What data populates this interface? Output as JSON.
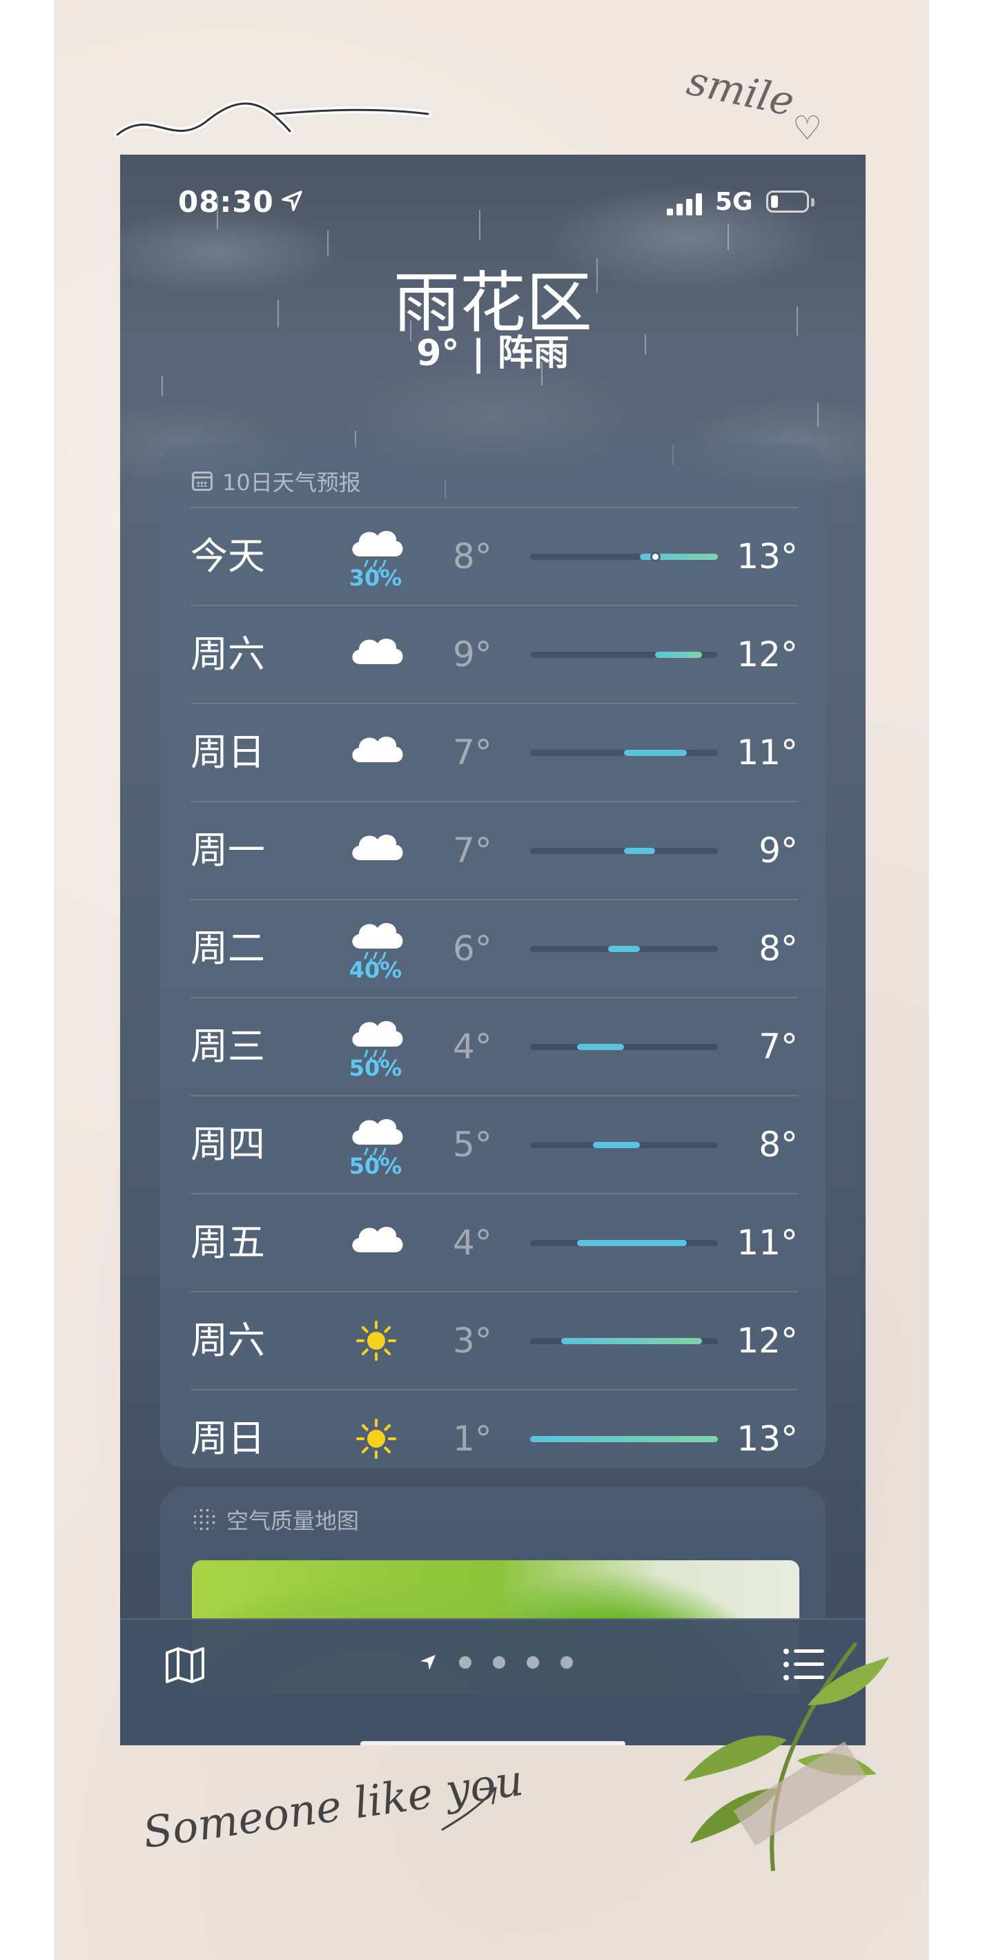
{
  "status_bar": {
    "time": "08:30",
    "network": "5G"
  },
  "location": {
    "city": "雨花区",
    "summary": "9° | 阵雨"
  },
  "forecast_card": {
    "title": "10日天气预报",
    "days": [
      {
        "day": "今天",
        "icon": "cloud-rain-icon",
        "precip": "30%",
        "low": "8°",
        "high": "13°",
        "low_value": 8,
        "high_value": 13,
        "current": 9
      },
      {
        "day": "周六",
        "icon": "cloud-icon",
        "precip": "",
        "low": "9°",
        "high": "12°",
        "low_value": 9,
        "high_value": 12
      },
      {
        "day": "周日",
        "icon": "cloud-icon",
        "precip": "",
        "low": "7°",
        "high": "11°",
        "low_value": 7,
        "high_value": 11
      },
      {
        "day": "周一",
        "icon": "cloud-icon",
        "precip": "",
        "low": "7°",
        "high": "9°",
        "low_value": 7,
        "high_value": 9
      },
      {
        "day": "周二",
        "icon": "cloud-rain-icon",
        "precip": "40%",
        "low": "6°",
        "high": "8°",
        "low_value": 6,
        "high_value": 8
      },
      {
        "day": "周三",
        "icon": "cloud-rain-icon",
        "precip": "50%",
        "low": "4°",
        "high": "7°",
        "low_value": 4,
        "high_value": 7
      },
      {
        "day": "周四",
        "icon": "cloud-rain-icon",
        "precip": "50%",
        "low": "5°",
        "high": "8°",
        "low_value": 5,
        "high_value": 8
      },
      {
        "day": "周五",
        "icon": "cloud-icon",
        "precip": "",
        "low": "4°",
        "high": "11°",
        "low_value": 4,
        "high_value": 11
      },
      {
        "day": "周六",
        "icon": "sun-icon",
        "precip": "",
        "low": "3°",
        "high": "12°",
        "low_value": 3,
        "high_value": 12
      },
      {
        "day": "周日",
        "icon": "sun-icon",
        "precip": "",
        "low": "1°",
        "high": "13°",
        "low_value": 1,
        "high_value": 13
      }
    ]
  },
  "air_quality_card": {
    "title": "空气质量地图"
  },
  "tab_bar": {
    "page_dots": 4
  },
  "decorations": {
    "smile": "smile",
    "someone": "Someone like you"
  },
  "colors": {
    "precip": "#5fc7f2",
    "bar_cool": "#5bc3de",
    "bar_warm": "#7fd3a6",
    "sun": "#f7d21a"
  }
}
